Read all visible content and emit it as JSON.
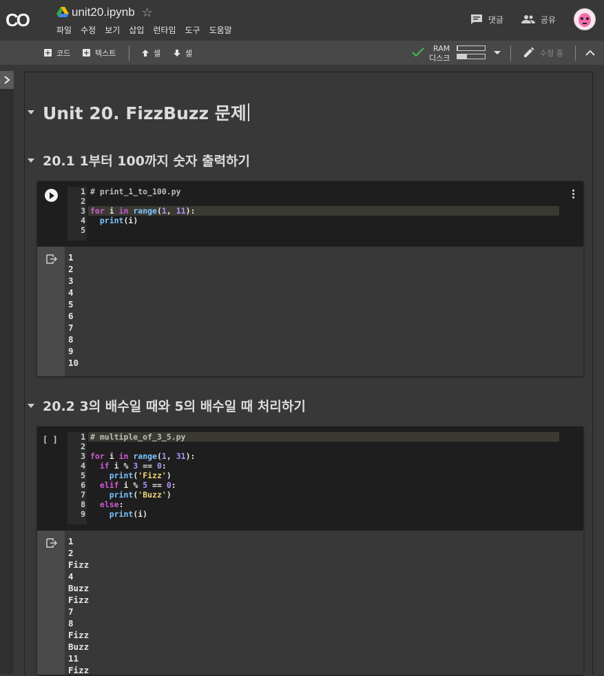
{
  "app": {
    "logo": "CO",
    "notebook_title": "unit20.ipynb",
    "star": "☆"
  },
  "menu": [
    "파일",
    "수정",
    "보기",
    "삽입",
    "런타임",
    "도구",
    "도움말"
  ],
  "header_right": {
    "comment_label": "댓글",
    "share_label": "공유"
  },
  "toolbar": {
    "add_code": "코드",
    "add_text": "텍스트",
    "cell_up": "셀",
    "cell_down": "셀",
    "ram_label": "RAM",
    "disk_label": "디스크",
    "ram_fill": 0.03,
    "disk_fill": 0.35,
    "edit_label": "수정 중"
  },
  "notebook": {
    "title": "Unit 20. FizzBuzz 문제",
    "section1": "20.1 1부터 100까지 숫자 출력하기",
    "section2": "20.2 3의 배수일 때와 5의 배수일 때 처리하기",
    "cell1": {
      "lines": [
        {
          "n": "1",
          "code": "# print_1_to_100.py"
        },
        {
          "n": "2",
          "code": ""
        },
        {
          "n": "3",
          "code": "for i in range(1, 11):"
        },
        {
          "n": "4",
          "code": "  print(i)"
        },
        {
          "n": "5",
          "code": ""
        }
      ],
      "output": [
        "1",
        "2",
        "3",
        "4",
        "5",
        "6",
        "7",
        "8",
        "9",
        "10"
      ]
    },
    "cell2": {
      "exec_count": "[ ]",
      "lines": [
        {
          "n": "1",
          "code": "# multiple_of_3_5.py"
        },
        {
          "n": "2",
          "code": ""
        },
        {
          "n": "3",
          "code": "for i in range(1, 31):"
        },
        {
          "n": "4",
          "code": "  if i % 3 == 0:"
        },
        {
          "n": "5",
          "code": "    print('Fizz')"
        },
        {
          "n": "6",
          "code": "  elif i % 5 == 0:"
        },
        {
          "n": "7",
          "code": "    print('Buzz')"
        },
        {
          "n": "8",
          "code": "  else:"
        },
        {
          "n": "9",
          "code": "    print(i)"
        }
      ],
      "output": [
        "1",
        "2",
        "Fizz",
        "4",
        "Buzz",
        "Fizz",
        "7",
        "8",
        "Fizz",
        "Buzz",
        "11",
        "Fizz"
      ]
    }
  }
}
